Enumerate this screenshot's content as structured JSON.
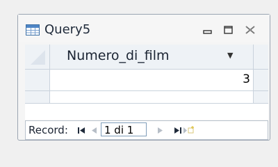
{
  "window": {
    "title": "Query5",
    "icon": "datasheet-view-icon",
    "controls": [
      "minimize-icon",
      "restore-icon",
      "close-icon"
    ]
  },
  "datasheet": {
    "columns": [
      {
        "name": "Numero_di_film",
        "has_dropdown": true
      }
    ],
    "rows": [
      {
        "Numero_di_film": "3"
      }
    ]
  },
  "navigation": {
    "label": "Record:",
    "current": "1 di 1",
    "buttons": [
      "first-record-icon",
      "previous-record-icon",
      "next-record-icon",
      "last-record-icon",
      "new-record-icon"
    ]
  }
}
